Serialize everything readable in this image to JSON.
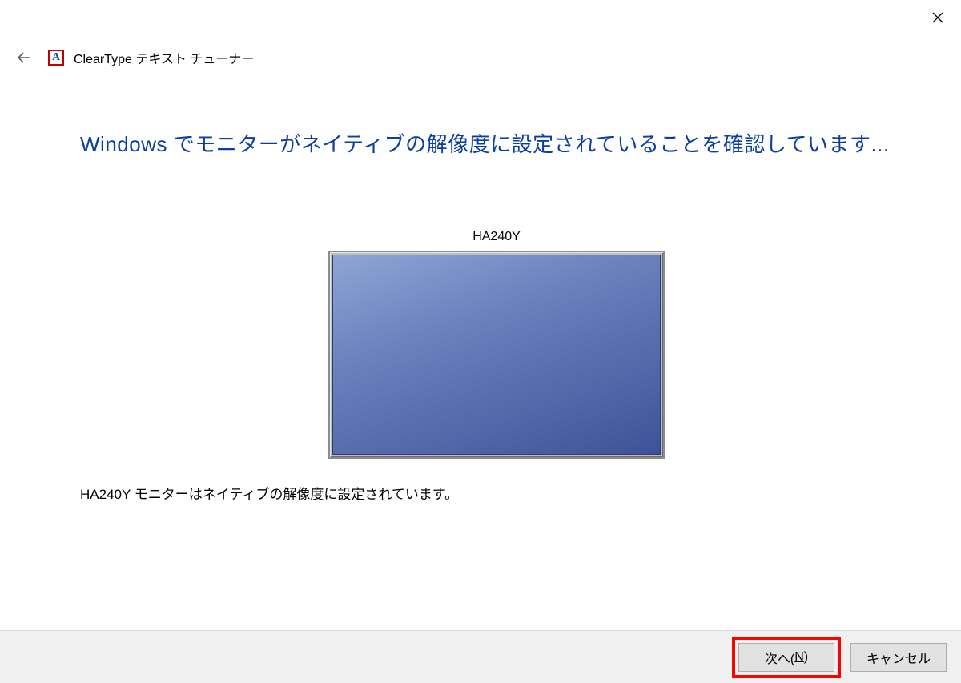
{
  "window": {
    "app_title": "ClearType テキスト チューナー",
    "app_icon_letter": "A"
  },
  "main": {
    "heading": "Windows でモニターがネイティブの解像度に設定されていることを確認しています...",
    "monitor_name": "HA240Y",
    "status_text": "HA240Y モニターはネイティブの解像度に設定されています。"
  },
  "footer": {
    "next_label_prefix": "次へ(",
    "next_mnemonic": "N",
    "next_label_suffix": ")",
    "cancel_label": "キャンセル"
  }
}
